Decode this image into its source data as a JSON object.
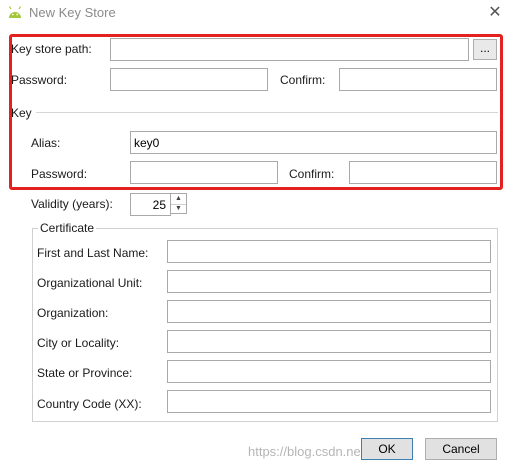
{
  "window": {
    "title": "New Key Store",
    "close_glyph": "✕",
    "icon": "android-icon"
  },
  "key_store": {
    "path_label": "Key store path:",
    "path_value": "",
    "browse_label": "...",
    "password_label": "Password:",
    "password_value": "",
    "confirm_label": "Confirm:",
    "confirm_value": ""
  },
  "key": {
    "section_label": "Key",
    "alias_label": "Alias:",
    "alias_value": "key0",
    "password_label": "Password:",
    "password_value": "",
    "confirm_label": "Confirm:",
    "confirm_value": "",
    "validity_label": "Validity (years):",
    "validity_value": "25"
  },
  "certificate": {
    "section_label": "Certificate",
    "fields": [
      {
        "label": "First and Last Name:",
        "value": ""
      },
      {
        "label": "Organizational Unit:",
        "value": ""
      },
      {
        "label": "Organization:",
        "value": ""
      },
      {
        "label": "City or Locality:",
        "value": ""
      },
      {
        "label": "State or Province:",
        "value": ""
      },
      {
        "label": "Country Code (XX):",
        "value": ""
      }
    ]
  },
  "buttons": {
    "ok": "OK",
    "cancel": "Cancel"
  },
  "watermark": "https://blog.csdn.net/...",
  "colors": {
    "highlight_box": "#e3221f",
    "android_green": "#a4c639",
    "ok_border": "#3c7fb1"
  }
}
